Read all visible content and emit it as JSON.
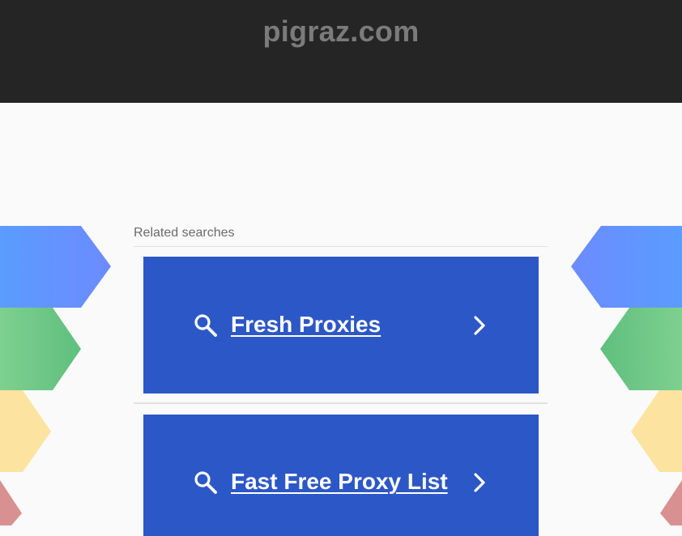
{
  "header": {
    "domain": "pigraz.com"
  },
  "related": {
    "title": "Related searches",
    "items": [
      {
        "label": "Fresh Proxies"
      },
      {
        "label": "Fast Free Proxy List"
      }
    ]
  },
  "colors": {
    "header_bg": "#252525",
    "page_bg": "#fafafa",
    "card_bg": "#2c57c7",
    "deco_blue": "#6595fb",
    "deco_green": "#73c98a",
    "deco_yellow": "#fde3a0",
    "deco_red": "#d99090"
  },
  "icons": {
    "search": "search-icon",
    "chevron": "chevron-right-icon"
  }
}
